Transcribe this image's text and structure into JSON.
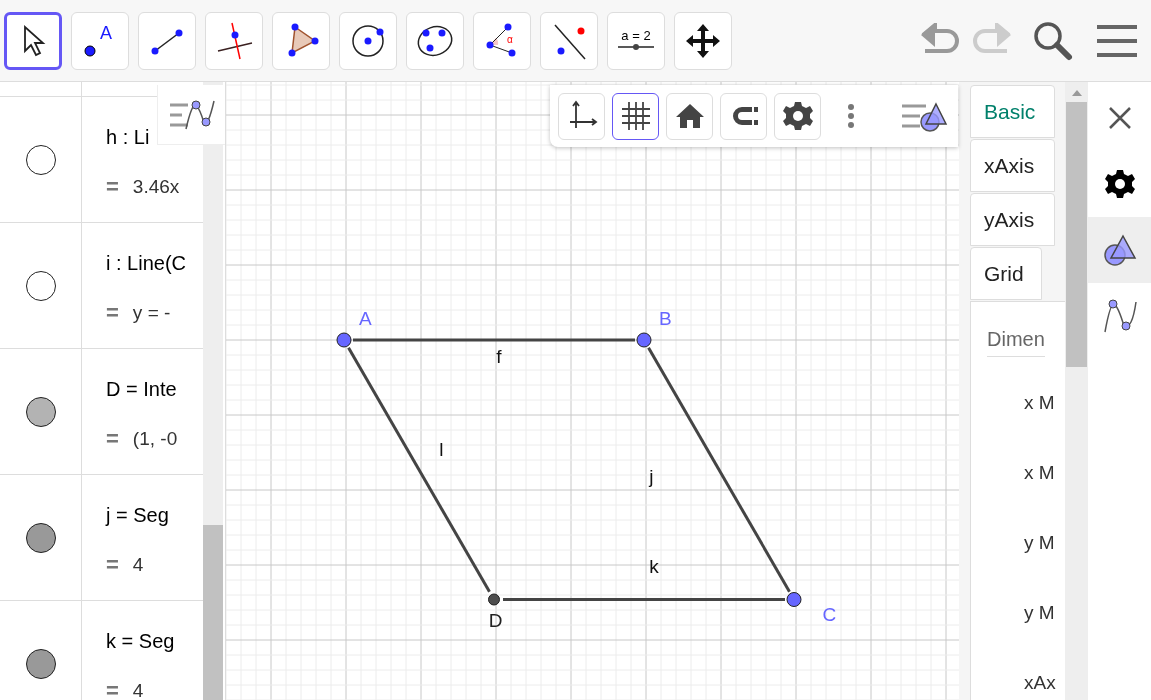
{
  "toolbar": {
    "tools": [
      {
        "kind": "move",
        "selected": true
      },
      {
        "kind": "point",
        "selected": false,
        "label": "A"
      },
      {
        "kind": "segment",
        "selected": false
      },
      {
        "kind": "perpendicular",
        "selected": false
      },
      {
        "kind": "polygon",
        "selected": false
      },
      {
        "kind": "circle",
        "selected": false
      },
      {
        "kind": "conic",
        "selected": false
      },
      {
        "kind": "angle",
        "selected": false,
        "label": "α"
      },
      {
        "kind": "reflect",
        "selected": false
      },
      {
        "kind": "slider",
        "selected": false,
        "label": "a = 2"
      },
      {
        "kind": "pan",
        "selected": false
      }
    ],
    "undo_disabled": false,
    "redo_disabled": true
  },
  "algebra": {
    "rows": [
      {
        "visible": false,
        "definition": "h : Li",
        "value": "3.46x"
      },
      {
        "visible": false,
        "definition": "i : Line(C",
        "value": "y = -"
      },
      {
        "kind": "point",
        "visible": true,
        "definition": "D = Inte",
        "value": "(1, -0"
      },
      {
        "kind": "segment",
        "visible": true,
        "definition": "j = Seg",
        "value": "4"
      },
      {
        "kind": "segment",
        "visible": true,
        "definition": "k = Seg",
        "value": "4"
      }
    ],
    "value_prefix": "="
  },
  "graphics": {
    "style_bar": [
      {
        "kind": "axes",
        "selected": false
      },
      {
        "kind": "grid",
        "selected": true
      },
      {
        "kind": "home",
        "selected": false
      },
      {
        "kind": "magnet",
        "selected": false
      },
      {
        "kind": "gear",
        "selected": false
      }
    ],
    "points": [
      {
        "name": "A",
        "color": "#6666ff"
      },
      {
        "name": "B",
        "color": "#6666ff"
      },
      {
        "name": "C",
        "color": "#6666ff"
      },
      {
        "name": "D",
        "color": "#4d4d4d"
      }
    ],
    "segments": [
      {
        "name": "f"
      },
      {
        "name": "l"
      },
      {
        "name": "j"
      },
      {
        "name": "k"
      }
    ]
  },
  "properties": {
    "tabs": [
      {
        "label": "Basic",
        "selected": true
      },
      {
        "label": "xAxis",
        "selected": false
      },
      {
        "label": "yAxis",
        "selected": false
      },
      {
        "label": "Grid",
        "selected": false
      }
    ],
    "section": "Dimen",
    "fields": [
      "x M",
      "x M",
      "y M",
      "y M",
      "xAx"
    ]
  },
  "sidebar": {
    "items": [
      {
        "kind": "close",
        "selected": false
      },
      {
        "kind": "gear",
        "selected": false
      },
      {
        "kind": "graphics",
        "selected": true
      },
      {
        "kind": "algebra",
        "selected": false
      }
    ]
  }
}
